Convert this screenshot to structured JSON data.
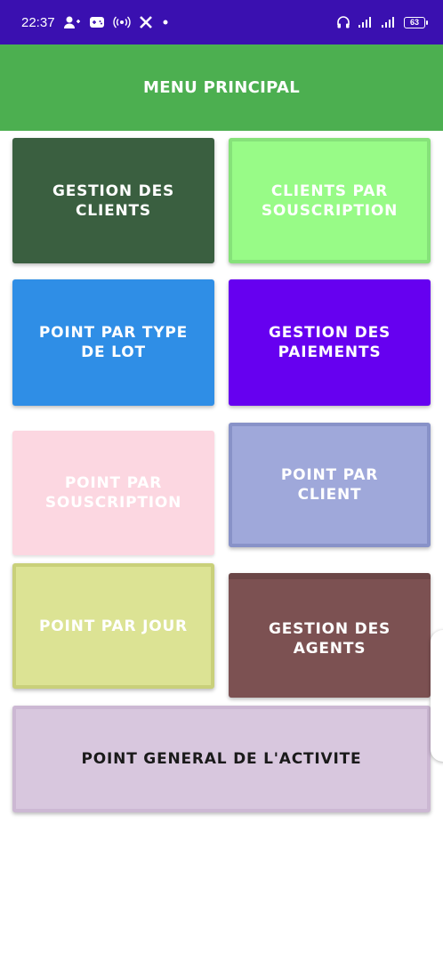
{
  "status_bar": {
    "time": "22:37",
    "battery": "63",
    "icons_left": [
      "person-add-icon",
      "gamepad-icon",
      "hotspot-icon",
      "x-icon",
      "dot-icon"
    ],
    "icons_right": [
      "headphones-icon",
      "signal-icon",
      "signal-icon",
      "battery-icon"
    ]
  },
  "app_bar": {
    "title": "MENU PRINCIPAL",
    "color": "#4caf50"
  },
  "menu": {
    "gestion_clients": {
      "line1": "GESTION DES",
      "line2": "CLIENTS",
      "color": "#3a5f40"
    },
    "clients_souscription": {
      "line1": "CLIENTS PAR",
      "line2": "SOUSCRIPTION",
      "color": "#98fb87"
    },
    "point_type_lot": {
      "line1": "POINT PAR TYPE",
      "line2": "DE LOT",
      "color": "#2f8ee6"
    },
    "gestion_paiements": {
      "line1": "GESTION DES",
      "line2": "PAIEMENTS",
      "color": "#6600f0"
    },
    "point_souscription": {
      "line1": "POINT PAR",
      "line2": "SOUSCRIPTION",
      "color": "#fcd7e1"
    },
    "point_client": {
      "label": "POINT PAR CLIENT",
      "color": "#9fa8da"
    },
    "point_jour": {
      "label": "POINT PAR JOUR",
      "color": "#dce394"
    },
    "gestion_agents": {
      "line1": "GESTION DES",
      "line2": "AGENTS",
      "color": "#7c5152"
    },
    "point_general": {
      "label": "POINT GENERAL DE L'ACTIVITE",
      "color": "#d8c7de"
    }
  }
}
